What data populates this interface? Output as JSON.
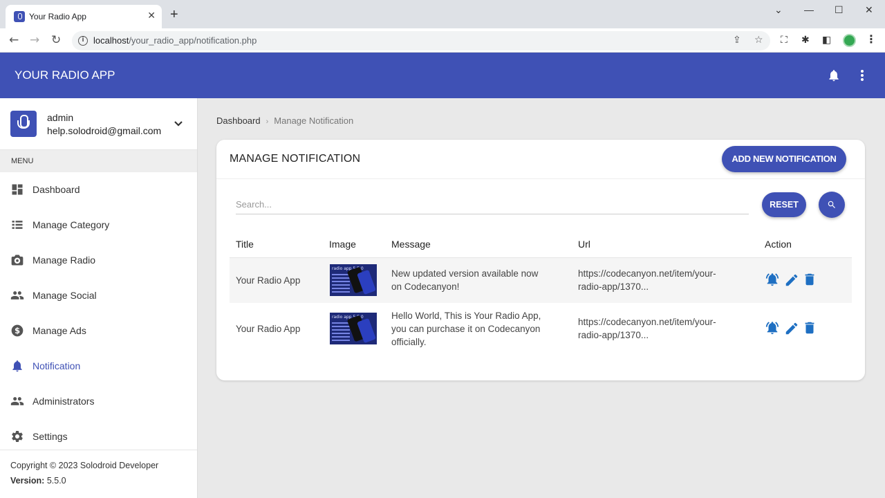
{
  "browser": {
    "tab_title": "Your Radio App",
    "tab_close": "✕",
    "new_tab": "+",
    "url_host": "localhost",
    "url_path": "/your_radio_app/notification.php",
    "win_minimize": "—",
    "win_restore": "☐",
    "win_close": "✕",
    "win_dropdown": "⌄"
  },
  "header": {
    "app_name": "YOUR RADIO APP",
    "color": "#3f51b5"
  },
  "user": {
    "name": "admin",
    "email": "help.solodroid@gmail.com"
  },
  "sidebar": {
    "menu_label": "MENU",
    "items": [
      {
        "label": "Dashboard",
        "icon": "dashboard-icon"
      },
      {
        "label": "Manage Category",
        "icon": "list-icon"
      },
      {
        "label": "Manage Radio",
        "icon": "radio-icon"
      },
      {
        "label": "Manage Social",
        "icon": "people-icon"
      },
      {
        "label": "Manage Ads",
        "icon": "dollar-icon"
      },
      {
        "label": "Notification",
        "icon": "bell-icon",
        "active": true
      },
      {
        "label": "Administrators",
        "icon": "people-icon"
      },
      {
        "label": "Settings",
        "icon": "gear-icon"
      }
    ],
    "footer": {
      "copyright": "Copyright © 2023 Solodroid Developer",
      "version_label": "Version:",
      "version": "5.5.0"
    }
  },
  "breadcrumb": {
    "home": "Dashboard",
    "separator": "›",
    "current": "Manage Notification"
  },
  "card": {
    "title": "MANAGE NOTIFICATION",
    "add_button": "ADD NEW NOTIFICATION",
    "search_placeholder": "Search...",
    "reset_button": "RESET"
  },
  "table": {
    "headers": [
      "Title",
      "Image",
      "Message",
      "Url",
      "Action"
    ],
    "rows": [
      {
        "title": "Your Radio App",
        "image_text": "radio app 5.5.0",
        "message_line1": "New updated version available now",
        "message_line2": "on Codecanyon!",
        "message_line3": "",
        "url_line1": "https://codecanyon.net/item/your-",
        "url_line2": "radio-app/1370..."
      },
      {
        "title": "Your Radio App",
        "image_text": "radio app 5.5.0",
        "message_line1": "Hello World, This is Your Radio App,",
        "message_line2": "you can purchase it on Codecanyon",
        "message_line3": "officially.",
        "url_line1": "https://codecanyon.net/item/your-",
        "url_line2": "radio-app/1370..."
      }
    ]
  },
  "colors": {
    "accent": "#3f51b5",
    "action_icon": "#1e6fc2"
  }
}
